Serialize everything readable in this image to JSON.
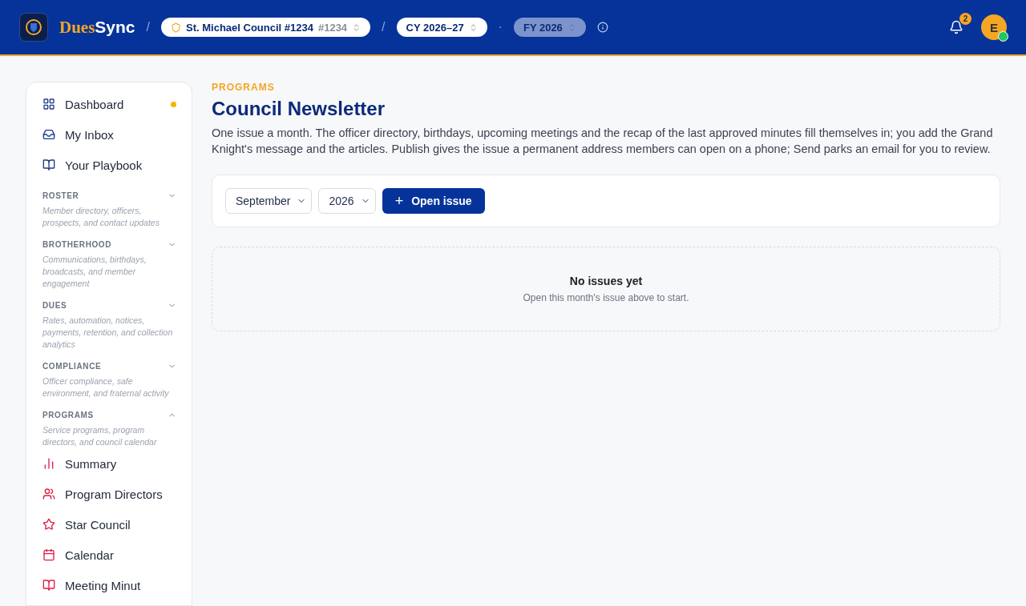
{
  "header": {
    "brand_first": "Dues",
    "brand_second": "Sync",
    "separators": [
      "/",
      "/",
      "·"
    ],
    "council": {
      "name": "St. Michael Council #1234",
      "number": "#1234"
    },
    "term": {
      "label": "CY 2026–27",
      "selected": true
    },
    "fiscal": {
      "label": "FY 2026",
      "selected": false
    },
    "notifications": {
      "count": "2"
    },
    "avatar": {
      "initial": "E"
    }
  },
  "sidebar": {
    "top_items": [
      {
        "label": "Dashboard",
        "dot": true
      },
      {
        "label": "My Inbox",
        "dot": false
      },
      {
        "label": "Your Playbook",
        "dot": false
      }
    ],
    "sections": [
      {
        "title": "ROSTER",
        "description": "Member directory, officers, prospects, and contact updates",
        "expanded": false
      },
      {
        "title": "BROTHERHOOD",
        "description": "Communications, birthdays, broadcasts, and member engagement",
        "expanded": false
      },
      {
        "title": "DUES",
        "description": "Rates, automation, notices, payments, retention, and collection analytics",
        "expanded": false
      },
      {
        "title": "COMPLIANCE",
        "description": "Officer compliance, safe environment, and fraternal activity",
        "expanded": false
      },
      {
        "title": "PROGRAMS",
        "description": "Service programs, program directors, and council calendar",
        "expanded": true,
        "items": [
          {
            "label": "Summary"
          },
          {
            "label": "Program Directors"
          },
          {
            "label": "Star Council"
          },
          {
            "label": "Calendar"
          },
          {
            "label": "Meeting Minut"
          }
        ]
      }
    ]
  },
  "page": {
    "eyebrow": "PROGRAMS",
    "title": "Council Newsletter",
    "description": "One issue a month. The officer directory, birthdays, upcoming meetings and the recap of the last approved minutes fill themselves in; you add the Grand Knight's message and the articles. Publish gives the issue a permanent address members can open on a phone; Send parks an email for you to review.",
    "month": "September",
    "year": "2026",
    "button": "+",
    "button_label": "Open issue",
    "empty": {
      "title": "No issues yet",
      "hint": "Open this month's issue above to start."
    }
  }
}
